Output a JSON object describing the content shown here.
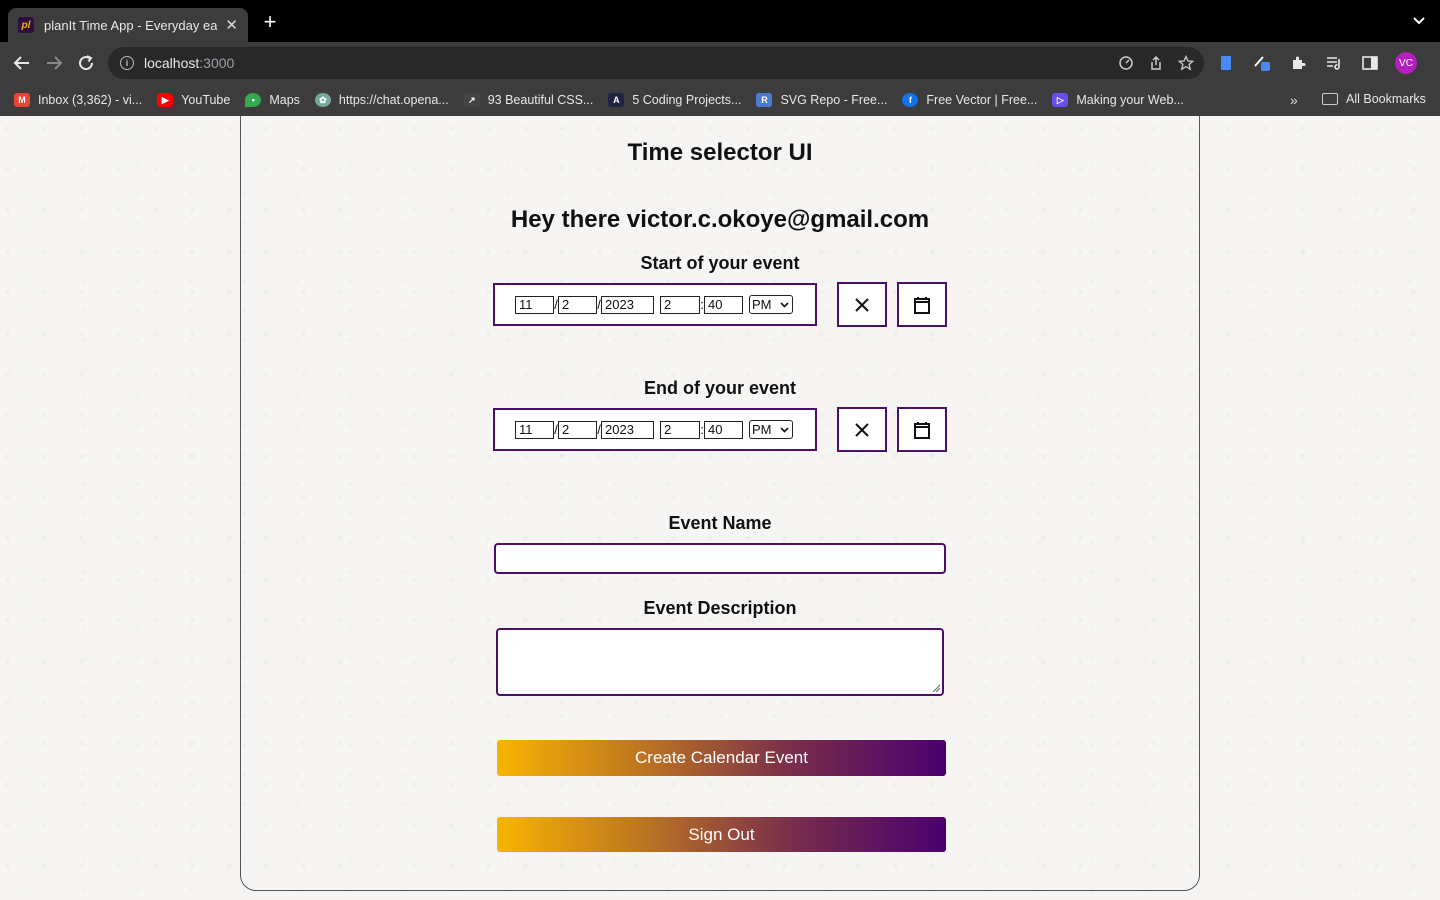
{
  "browser": {
    "tab_title": "planIt Time App - Everyday eas",
    "favicon_text": "pl",
    "url_host": "localhost",
    "url_port": ":3000",
    "avatar_initials": "VC",
    "bookmarks": [
      {
        "label": "Inbox (3,362) - vi...",
        "icon": "gmail-icon",
        "color": "#ea4335"
      },
      {
        "label": "YouTube",
        "icon": "youtube-icon",
        "color": "#ff0000"
      },
      {
        "label": "Maps",
        "icon": "maps-icon",
        "color": "#34a853"
      },
      {
        "label": "https://chat.opena...",
        "icon": "openai-icon",
        "color": "#74aa9c"
      },
      {
        "label": "93 Beautiful CSS...",
        "icon": "css-icon",
        "color": "#444444"
      },
      {
        "label": "5 Coding Projects...",
        "icon": "coding-icon",
        "color": "#222244"
      },
      {
        "label": "SVG Repo - Free...",
        "icon": "svgrepo-icon",
        "color": "#4a7bd0"
      },
      {
        "label": "Free Vector | Free...",
        "icon": "freepik-icon",
        "color": "#1273eb"
      },
      {
        "label": "Making your Web...",
        "icon": "web-icon",
        "color": "#6b4ef0"
      }
    ],
    "all_bookmarks_label": "All Bookmarks"
  },
  "page": {
    "title": "Time selector UI",
    "greeting": "Hey there victor.c.okoye@gmail.com",
    "start": {
      "label": "Start of your event",
      "month": "11",
      "day": "2",
      "year": "2023",
      "hour": "2",
      "minute": "40",
      "ampm": "PM"
    },
    "end": {
      "label": "End of your event",
      "month": "11",
      "day": "2",
      "year": "2023",
      "hour": "2",
      "minute": "40",
      "ampm": "PM"
    },
    "event_name_label": "Event Name",
    "event_name_value": "",
    "event_description_label": "Event Description",
    "event_description_value": "",
    "create_button": "Create Calendar Event",
    "signout_button": "Sign Out",
    "accent_color": "#4a0f6b",
    "gradient_start": "#f7b500",
    "gradient_end": "#4a006e"
  }
}
